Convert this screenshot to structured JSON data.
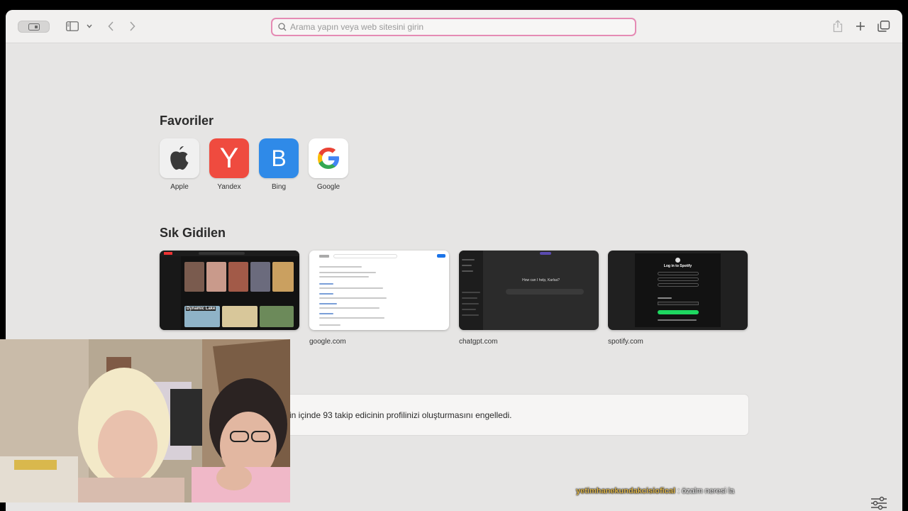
{
  "toolbar": {
    "address_placeholder": "Arama yapın veya web sitesini girin"
  },
  "favorites": {
    "title": "Favoriler",
    "items": [
      {
        "label": "Apple",
        "icon": "apple-logo-icon",
        "bg": "#f0f0f0"
      },
      {
        "label": "Yandex",
        "icon": "yandex-logo-icon",
        "bg": "#ef4b3f",
        "letter": "Y"
      },
      {
        "label": "Bing",
        "icon": "bing-logo-icon",
        "bg": "#2f8ae8",
        "letter": "B"
      },
      {
        "label": "Google",
        "icon": "google-logo-icon",
        "bg": "#ffffff"
      }
    ]
  },
  "frequent": {
    "title": "Sık Gidilen",
    "items": [
      {
        "label": ""
      },
      {
        "label": "google.com"
      },
      {
        "label": "chatgpt.com",
        "prompt": "How can I help, Karlsa?"
      },
      {
        "label": "spotify.com",
        "heading": "Log in to Spotify"
      }
    ]
  },
  "thumbnails": {
    "youtube_banner": "Dynamic Lake"
  },
  "notice": {
    "text": "in içinde 93 takip edicinin profilinizi oluşturmasını engelledi."
  },
  "stream_chat": {
    "user": "yetimhanekundakcisiofical",
    "message": ": özalm neresi la"
  },
  "colors": {
    "address_border": "#e58bb4",
    "page_bg": "#e6e5e4",
    "chat_user": "#d9b24a"
  }
}
